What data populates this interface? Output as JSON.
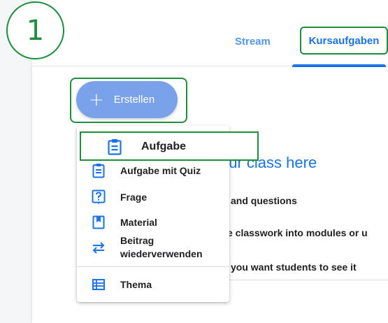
{
  "step_badge": "1",
  "tabs": {
    "stream": "Stream",
    "kursaufgaben": "Kursaufgaben"
  },
  "create_button": {
    "label": "Erstellen",
    "icon": "plus-icon"
  },
  "background": {
    "heading": "our class here",
    "line1": "and questions",
    "line2": "ze classwork into modules or u",
    "line3": "you want students to see it"
  },
  "menu": {
    "items": [
      {
        "label": "Aufgabe",
        "icon": "assignment-icon",
        "highlighted": true
      },
      {
        "label": "Aufgabe mit Quiz",
        "icon": "quiz-assignment-icon"
      },
      {
        "label": "Frage",
        "icon": "question-icon"
      },
      {
        "label": "Material",
        "icon": "material-icon"
      },
      {
        "label": "Beitrag\nwiederverwenden",
        "icon": "reuse-post-icon"
      },
      {
        "label": "Thema",
        "icon": "topic-icon"
      }
    ]
  },
  "colors": {
    "accent": "#1a73e8",
    "highlight": "#1e8e3e",
    "create_button": "#7aa2e8"
  }
}
